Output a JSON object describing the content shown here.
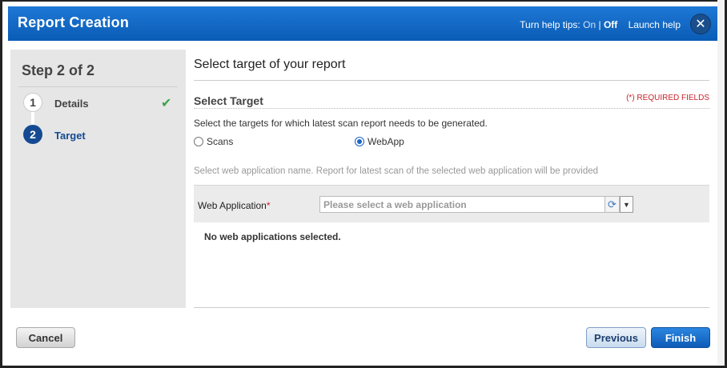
{
  "dialog": {
    "title": "Report Creation",
    "help_tips_label": "Turn help tips:",
    "help_on": "On",
    "help_separator": "|",
    "help_off": "Off",
    "launch_help": "Launch help",
    "close_icon": "close-icon"
  },
  "sidebar": {
    "step_title": "Step 2 of 2",
    "steps": [
      {
        "number": "1",
        "label": "Details",
        "status": "complete"
      },
      {
        "number": "2",
        "label": "Target",
        "status": "current"
      }
    ]
  },
  "main": {
    "heading": "Select target of your report",
    "section_title": "Select Target",
    "required_note": "(*) REQUIRED FIELDS",
    "description": "Select the targets for which latest scan report needs to be generated.",
    "radio_options": [
      {
        "label": "Scans",
        "selected": false
      },
      {
        "label": "WebApp",
        "selected": true
      }
    ],
    "hint": "Select web application name. Report for latest scan of the selected web application will be provided",
    "web_app_field": {
      "label": "Web Application",
      "required_mark": "*",
      "placeholder": "Please select a web application",
      "value": ""
    },
    "empty_message": "No web applications selected."
  },
  "footer": {
    "cancel": "Cancel",
    "previous": "Previous",
    "finish": "Finish"
  },
  "colors": {
    "header_blue": "#0a5cb5",
    "current_step": "#154a92",
    "required_red": "#c9232b",
    "check_green": "#3aa34a"
  }
}
